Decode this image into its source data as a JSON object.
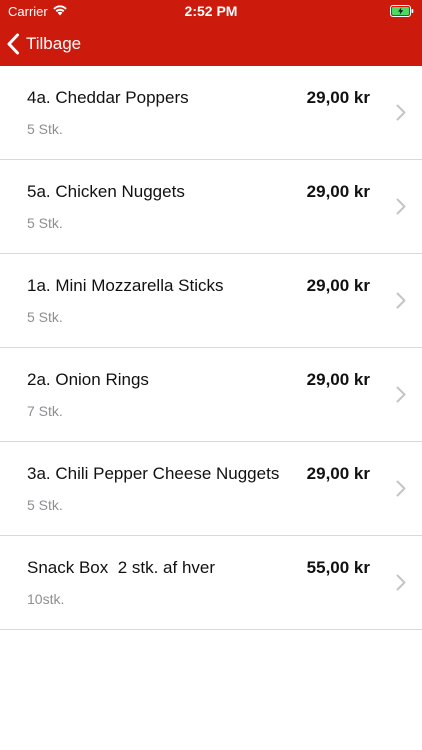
{
  "statusbar": {
    "carrier": "Carrier",
    "time": "2:52 PM",
    "wifi_icon": "wifi-icon",
    "battery_icon": "battery-charging-icon"
  },
  "navbar": {
    "back_label": "Tilbage",
    "back_icon": "chevron-left-icon",
    "background_color": "#cc1a0d"
  },
  "items": [
    {
      "name": "4a. Cheddar Poppers",
      "sub": "5 Stk.",
      "price": "29,00 kr"
    },
    {
      "name": "5a. Chicken Nuggets",
      "sub": "5 Stk.",
      "price": "29,00 kr"
    },
    {
      "name": "1a. Mini Mozzarella Sticks",
      "sub": "5 Stk.",
      "price": "29,00 kr"
    },
    {
      "name": "2a. Onion Rings",
      "sub": "7 Stk.",
      "price": "29,00 kr"
    },
    {
      "name": "3a. Chili Pepper Cheese Nuggets",
      "sub": "5 Stk.",
      "price": "29,00 kr"
    },
    {
      "name": "Snack Box  2 stk. af hver",
      "sub": "10stk.",
      "price": "55,00 kr"
    }
  ]
}
